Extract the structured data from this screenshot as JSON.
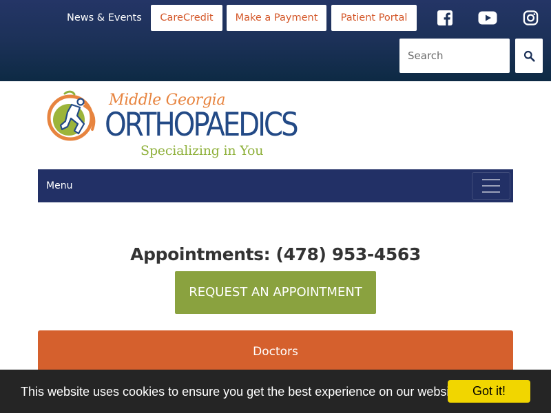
{
  "header": {
    "news_link": "News & Events",
    "buttons": {
      "carecredit": "CareCredit",
      "payment": "Make a Payment",
      "portal": "Patient Portal"
    },
    "social": [
      "facebook-icon",
      "youtube-icon",
      "instagram-icon"
    ],
    "search": {
      "placeholder": "Search",
      "button_icon": "search-icon"
    }
  },
  "logo": {
    "line1": "Middle Georgia",
    "line2": "ORTHOPAEDICS",
    "tagline": "Specializing in You"
  },
  "nav": {
    "menu_label": "Menu",
    "toggle_icon": "hamburger-icon"
  },
  "main": {
    "appointments": "Appointments: (478) 953-4563",
    "request_button": "REQUEST AN APPOINTMENT",
    "doctors": "Doctors"
  },
  "cookie": {
    "text": "This website uses cookies to ensure you get the best experience on our website",
    "button": "Got it!"
  },
  "colors": {
    "header_navy": "#1c3158",
    "nav_navy": "#223066",
    "accent_orange": "#d5602d",
    "accent_green": "#8aa23f",
    "logo_blue": "#234a86",
    "cookie_yellow": "#f1d600"
  }
}
